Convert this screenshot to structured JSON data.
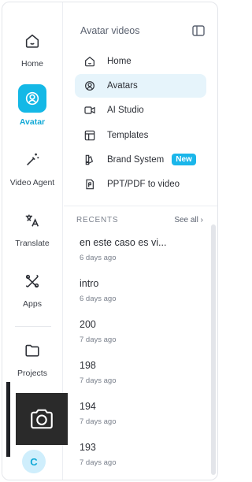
{
  "rail": {
    "items": [
      {
        "label": "Home",
        "icon": "home-icon"
      },
      {
        "label": "Avatar",
        "icon": "avatar-icon"
      },
      {
        "label": "Video Agent",
        "icon": "magic-wand-icon"
      },
      {
        "label": "Translate",
        "icon": "translate-icon"
      },
      {
        "label": "Apps",
        "icon": "apps-icon"
      },
      {
        "label": "Projects",
        "icon": "folder-icon"
      }
    ],
    "user_initial": "C"
  },
  "panel": {
    "title": "Avatar videos",
    "nav": [
      {
        "label": "Home",
        "icon": "home-icon"
      },
      {
        "label": "Avatars",
        "icon": "avatar-icon"
      },
      {
        "label": "AI Studio",
        "icon": "video-camera-icon"
      },
      {
        "label": "Templates",
        "icon": "templates-icon"
      },
      {
        "label": "Brand System",
        "icon": "brand-kit-icon",
        "badge": "New"
      },
      {
        "label": "PPT/PDF to video",
        "icon": "ppt-icon"
      }
    ],
    "recents_title": "RECENTS",
    "see_all": "See all ›",
    "recents": [
      {
        "title": "en este caso es vi...",
        "date": "6 days ago"
      },
      {
        "title": "intro",
        "date": "6 days ago"
      },
      {
        "title": "200",
        "date": "7 days ago"
      },
      {
        "title": "198",
        "date": "7 days ago"
      },
      {
        "title": "194",
        "date": "7 days ago"
      },
      {
        "title": "193",
        "date": "7 days ago"
      }
    ]
  },
  "colors": {
    "accent": "#14b8e6",
    "active_bg": "#e6f4fb"
  }
}
